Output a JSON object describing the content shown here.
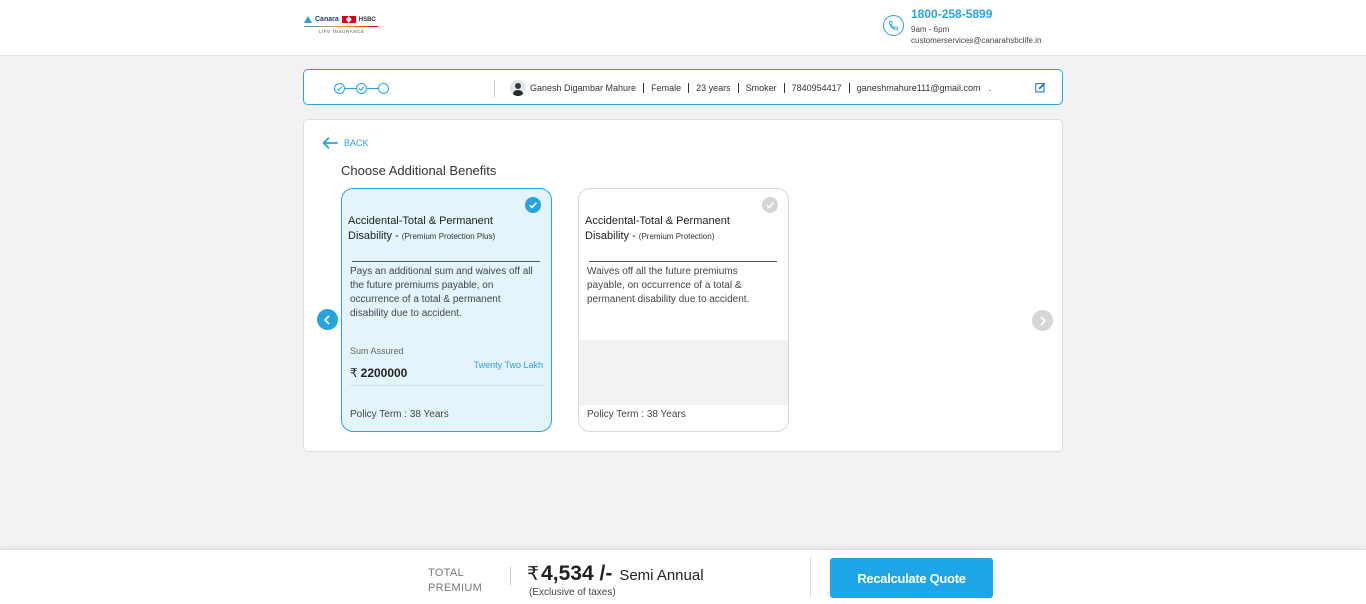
{
  "header": {
    "logo": {
      "brand": "Canara",
      "partner": "HSBC",
      "sub": "LIFE INSURANCE"
    },
    "contact": {
      "phone": "1800-258-5899",
      "hours": "9am - 6pm",
      "email": "customerservices@canarahsbclife.in"
    }
  },
  "profile": {
    "name": "Ganesh Digambar Mahure",
    "gender": "Female",
    "age": "23 years",
    "smoker": "Smoker",
    "mobile": "7840954417",
    "email": "ganeshmahure111@gmail.com",
    "trail": "."
  },
  "main": {
    "back_label": "BACK",
    "title": "Choose Additional Benefits",
    "cards": [
      {
        "title": "Accidental-Total & Permanent Disability -",
        "subtitle": "(Premium Protection Plus)",
        "description": "Pays an additional sum and waives off all the future premiums payable, on occurrence of a total & permanent disability due to accident.",
        "sum_assured_label": "Sum Assured",
        "sum_assured_words": "Twenty Two Lakh",
        "currency": "₹",
        "sum_assured_value": "2200000",
        "policy_term": "Policy Term : 38 Years",
        "selected": true
      },
      {
        "title": "Accidental-Total & Permanent Disability -",
        "subtitle": "(Premium Protection)",
        "description": "Waives off all the future premiums payable, on occurrence of a total & permanent disability due to accident.",
        "policy_term": "Policy Term : 38 Years",
        "selected": false
      }
    ]
  },
  "footer": {
    "total_label": "TOTAL PREMIUM",
    "currency": "₹",
    "amount": "4,534 /-",
    "frequency": "Semi Annual",
    "note": "(Exclusive of taxes)",
    "button_label": "Recalculate Quote"
  },
  "colors": {
    "accent": "#27a3e0",
    "selected_card_bg": "#e3f4fb",
    "button": "#1fa6e8"
  }
}
